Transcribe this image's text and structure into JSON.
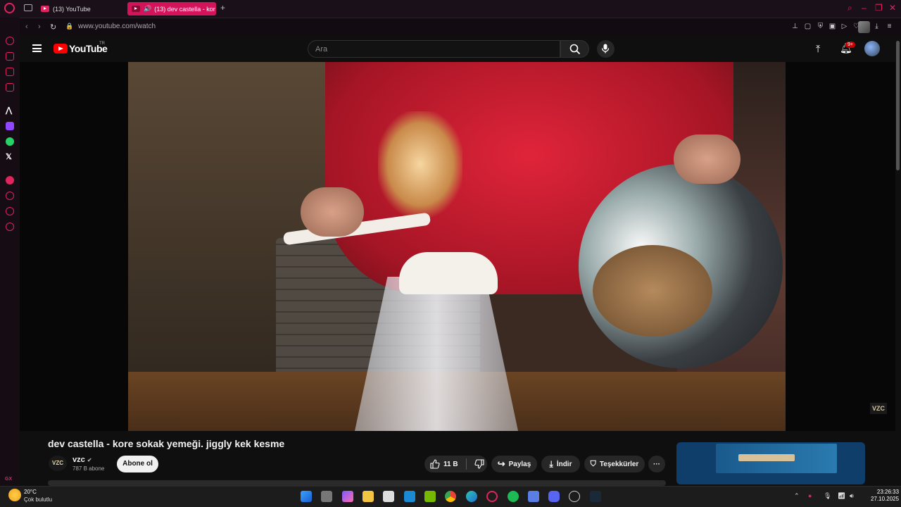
{
  "browser": {
    "tabs": [
      {
        "label": "(13) YouTube"
      },
      {
        "label": "(13) dev castella - kor"
      }
    ],
    "url": "www.youtube.com/watch",
    "new_tab": "+",
    "accent": "#e0245e"
  },
  "youtube": {
    "logo_text": "YouTube",
    "region": "TR",
    "search_placeholder": "Ara",
    "notifications_badge": "9+"
  },
  "video": {
    "title": "dev castella - kore sokak yemeği. jiggly kek kesme",
    "watermark": "VZC",
    "channel": {
      "avatar_text": "VZC",
      "name": "vzc",
      "verified": "✔",
      "subscribers": "787 B abone"
    },
    "subscribe_label": "Abone ol",
    "actions": {
      "likes": "11 B",
      "share": "Paylaş",
      "download": "İndir",
      "thanks": "Teşekkürler",
      "more": "···"
    }
  },
  "sidebar": {
    "gx_label": "GX",
    "more": "···"
  },
  "taskbar": {
    "weather": {
      "temp": "20°C",
      "condition": "Çok bulutlu"
    },
    "time": "23:26:33",
    "date": "27.10.2025"
  }
}
